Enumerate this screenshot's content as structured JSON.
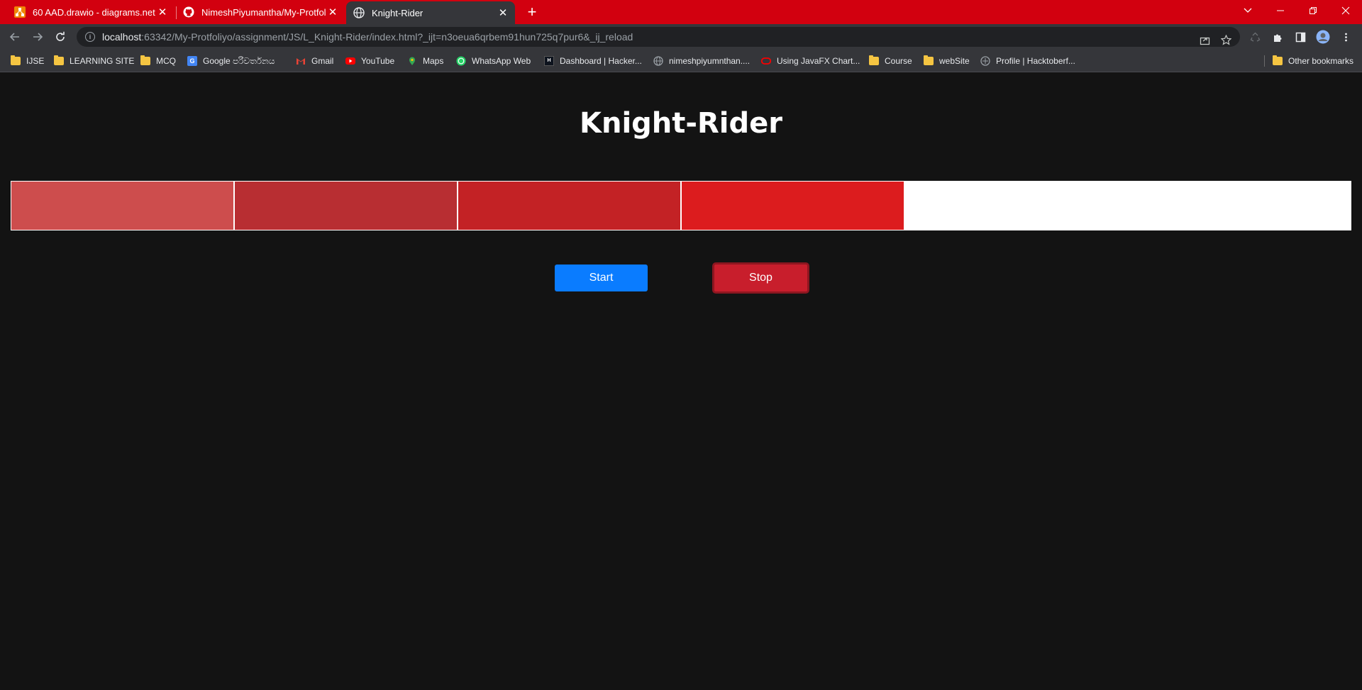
{
  "tabs": [
    {
      "title": "60 AAD.drawio - diagrams.net",
      "icon": "drawio-icon",
      "active": false
    },
    {
      "title": "NimeshPiyumantha/My-Protfoliyo",
      "icon": "github-icon",
      "active": false
    },
    {
      "title": "Knight-Rider",
      "icon": "globe-icon",
      "active": true
    }
  ],
  "address_bar": {
    "host": "localhost",
    "path": ":63342/My-Protfoliyo/assignment/JS/L_Knight-Rider/index.html?_ijt=n3oeua6qrbem91hun725q7pur6&_ij_reload"
  },
  "bookmarks": [
    {
      "label": "IJSE",
      "icon": "folder-icon"
    },
    {
      "label": "LEARNING SITE",
      "icon": "folder-icon"
    },
    {
      "label": "MCQ",
      "icon": "folder-icon"
    },
    {
      "label": "Google පරිවර්තනය",
      "icon": "google-translate-icon"
    },
    {
      "label": "Gmail",
      "icon": "gmail-icon"
    },
    {
      "label": "YouTube",
      "icon": "youtube-icon"
    },
    {
      "label": "Maps",
      "icon": "maps-icon"
    },
    {
      "label": "WhatsApp Web",
      "icon": "whatsapp-icon"
    },
    {
      "label": "Dashboard | Hacker...",
      "icon": "hackerrank-icon"
    },
    {
      "label": "nimeshpiyumnthan....",
      "icon": "globe-icon"
    },
    {
      "label": "Using JavaFX Chart...",
      "icon": "oracle-icon"
    },
    {
      "label": "Course",
      "icon": "folder-icon"
    },
    {
      "label": "webSite",
      "icon": "folder-icon"
    },
    {
      "label": "Profile | Hacktoberf...",
      "icon": "hacktoberfest-icon"
    }
  ],
  "other_bookmarks": "Other bookmarks",
  "page": {
    "heading": "Knight-Rider",
    "lights": [
      "#cd4d4d",
      "#b82e32",
      "#c32225",
      "#dc1c1e",
      "#ffffff",
      "#ffffff"
    ],
    "start_label": "Start",
    "stop_label": "Stop"
  },
  "colors": {
    "tab_strip": "#d2000f",
    "page_background": "#131313",
    "start_button": "#0a7cff",
    "stop_button": "#c81e2c"
  }
}
